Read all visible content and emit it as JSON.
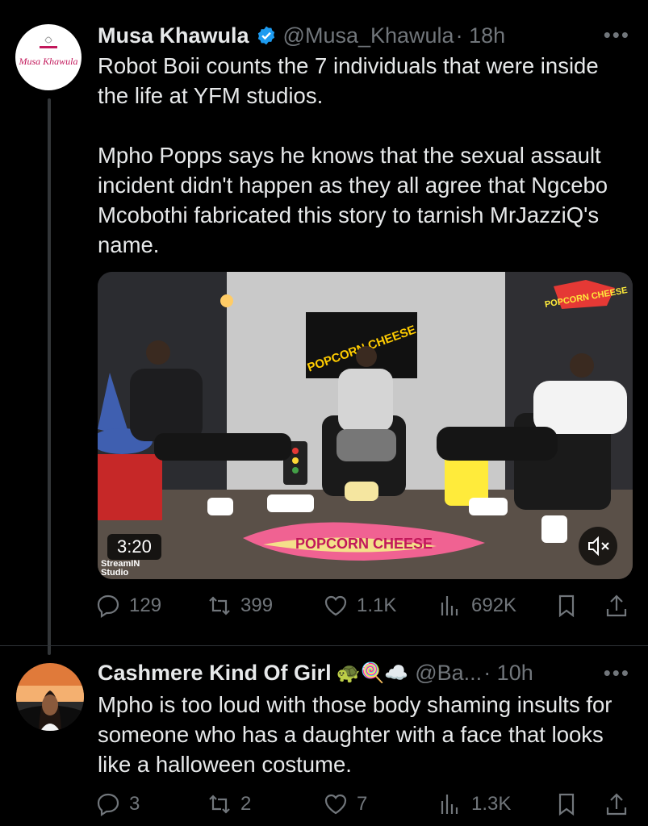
{
  "tweet1": {
    "author_name": "Musa Khawula",
    "handle": "@Musa_Khawula",
    "time": "· 18h",
    "avatar_text": "Musa Khawula",
    "text": "Robot Boii counts the 7 individuals that were inside the life at YFM studios.\n\nMpho Popps says he knows that the sexual assault incident didn't happen as they all agree that Ngcebo Mcobothi fabricated this story to tarnish MrJazziQ's name.",
    "video": {
      "duration": "3:20",
      "watermark": "StreamIN Studio",
      "show_logo": "POPCORN CHEESE",
      "floor_logo": "POPCORN CHEESE"
    },
    "replies": "129",
    "retweets": "399",
    "likes": "1.1K",
    "views": "692K"
  },
  "tweet2": {
    "author_name": "Cashmere Kind Of Girl",
    "emojis": "🐢🍭☁️",
    "handle": "@Ba...",
    "time": "· 10h",
    "text": "Mpho is too loud with those body shaming insults for someone who has a daughter with a face that looks like a halloween costume.",
    "replies": "3",
    "retweets": "2",
    "likes": "7",
    "views": "1.3K"
  },
  "colors": {
    "background": "#000000",
    "text": "#e7e9ea",
    "muted": "#71767b",
    "verified": "#1d9bf0"
  }
}
